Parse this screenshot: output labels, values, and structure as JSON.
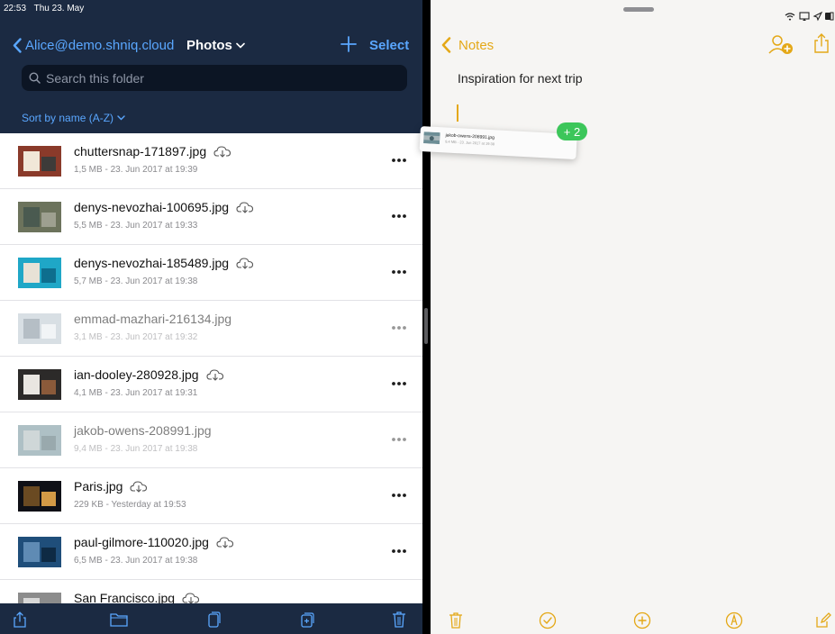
{
  "status_bar": {
    "time": "22:53",
    "date": "Thu 23. May"
  },
  "left": {
    "nav": {
      "back_label": "Alice@demo.shniq.cloud",
      "title": "Photos",
      "select_label": "Select"
    },
    "search": {
      "placeholder": "Search this folder"
    },
    "sort_label": "Sort by name (A-Z)",
    "files": [
      {
        "name": "chuttersnap-171897.jpg",
        "meta": "1,5 MB - 23. Jun 2017 at 19:39",
        "downloadable": true,
        "dimmed": false,
        "thumb_colors": [
          "#8a3a2a",
          "#f1e7d8",
          "#3d3b39"
        ]
      },
      {
        "name": "denys-nevozhai-100695.jpg",
        "meta": "5,5 MB - 23. Jun 2017 at 19:33",
        "downloadable": true,
        "dimmed": false,
        "thumb_colors": [
          "#6c735c",
          "#4a5a50",
          "#9ea090"
        ]
      },
      {
        "name": "denys-nevozhai-185489.jpg",
        "meta": "5,7 MB - 23. Jun 2017 at 19:38",
        "downloadable": true,
        "dimmed": false,
        "thumb_colors": [
          "#1fa7c7",
          "#e8e2d6",
          "#0e6e8e"
        ]
      },
      {
        "name": "emmad-mazhari-216134.jpg",
        "meta": "3,1 MB - 23. Jun 2017 at 19:32",
        "downloadable": false,
        "dimmed": true,
        "thumb_colors": [
          "#b9c6cf",
          "#7a8a96",
          "#e6ecef"
        ]
      },
      {
        "name": "ian-dooley-280928.jpg",
        "meta": "4,1 MB - 23. Jun 2017 at 19:31",
        "downloadable": true,
        "dimmed": false,
        "thumb_colors": [
          "#2c2a29",
          "#e9e6e1",
          "#8b5a3a"
        ]
      },
      {
        "name": "jakob-owens-208991.jpg",
        "meta": "9,4 MB - 23. Jun 2017 at 19:38",
        "downloadable": false,
        "dimmed": true,
        "thumb_colors": [
          "#6d8e96",
          "#a9b7ba",
          "#47636b"
        ]
      },
      {
        "name": "Paris.jpg",
        "meta": "229 KB - Yesterday at 19:53",
        "downloadable": true,
        "dimmed": false,
        "thumb_colors": [
          "#0f1016",
          "#6a4a22",
          "#d39a46"
        ]
      },
      {
        "name": "paul-gilmore-110020.jpg",
        "meta": "6,5 MB - 23. Jun 2017 at 19:38",
        "downloadable": true,
        "dimmed": false,
        "thumb_colors": [
          "#1f4e7a",
          "#5f8bb4",
          "#0e2a44"
        ]
      },
      {
        "name": "San Francisco.jpg",
        "meta": "",
        "downloadable": true,
        "dimmed": false,
        "thumb_colors": [
          "#8c8c8c",
          "#d8d8d8",
          "#5a5a5a"
        ]
      }
    ],
    "toolbar_icons": [
      "share-icon",
      "folder-icon",
      "copy-icon",
      "duplicate-icon",
      "trash-icon"
    ]
  },
  "right": {
    "nav": {
      "back_label": "Notes"
    },
    "note": {
      "title": "Inspiration for next trip"
    },
    "drag": {
      "badge": "+ 2",
      "preview_title": "jakob-owens-208991.jpg",
      "preview_meta": "9,4 MB - 23. Jun 2017 at 19:38"
    },
    "toolbar_icons": [
      "trash-icon",
      "checklist-icon",
      "add-icon",
      "markup-icon",
      "compose-icon"
    ]
  },
  "colors": {
    "left_header": "#1b2a42",
    "accent_blue": "#5aa7ff",
    "notes_accent": "#e4a817",
    "badge_green": "#3cc65a"
  }
}
